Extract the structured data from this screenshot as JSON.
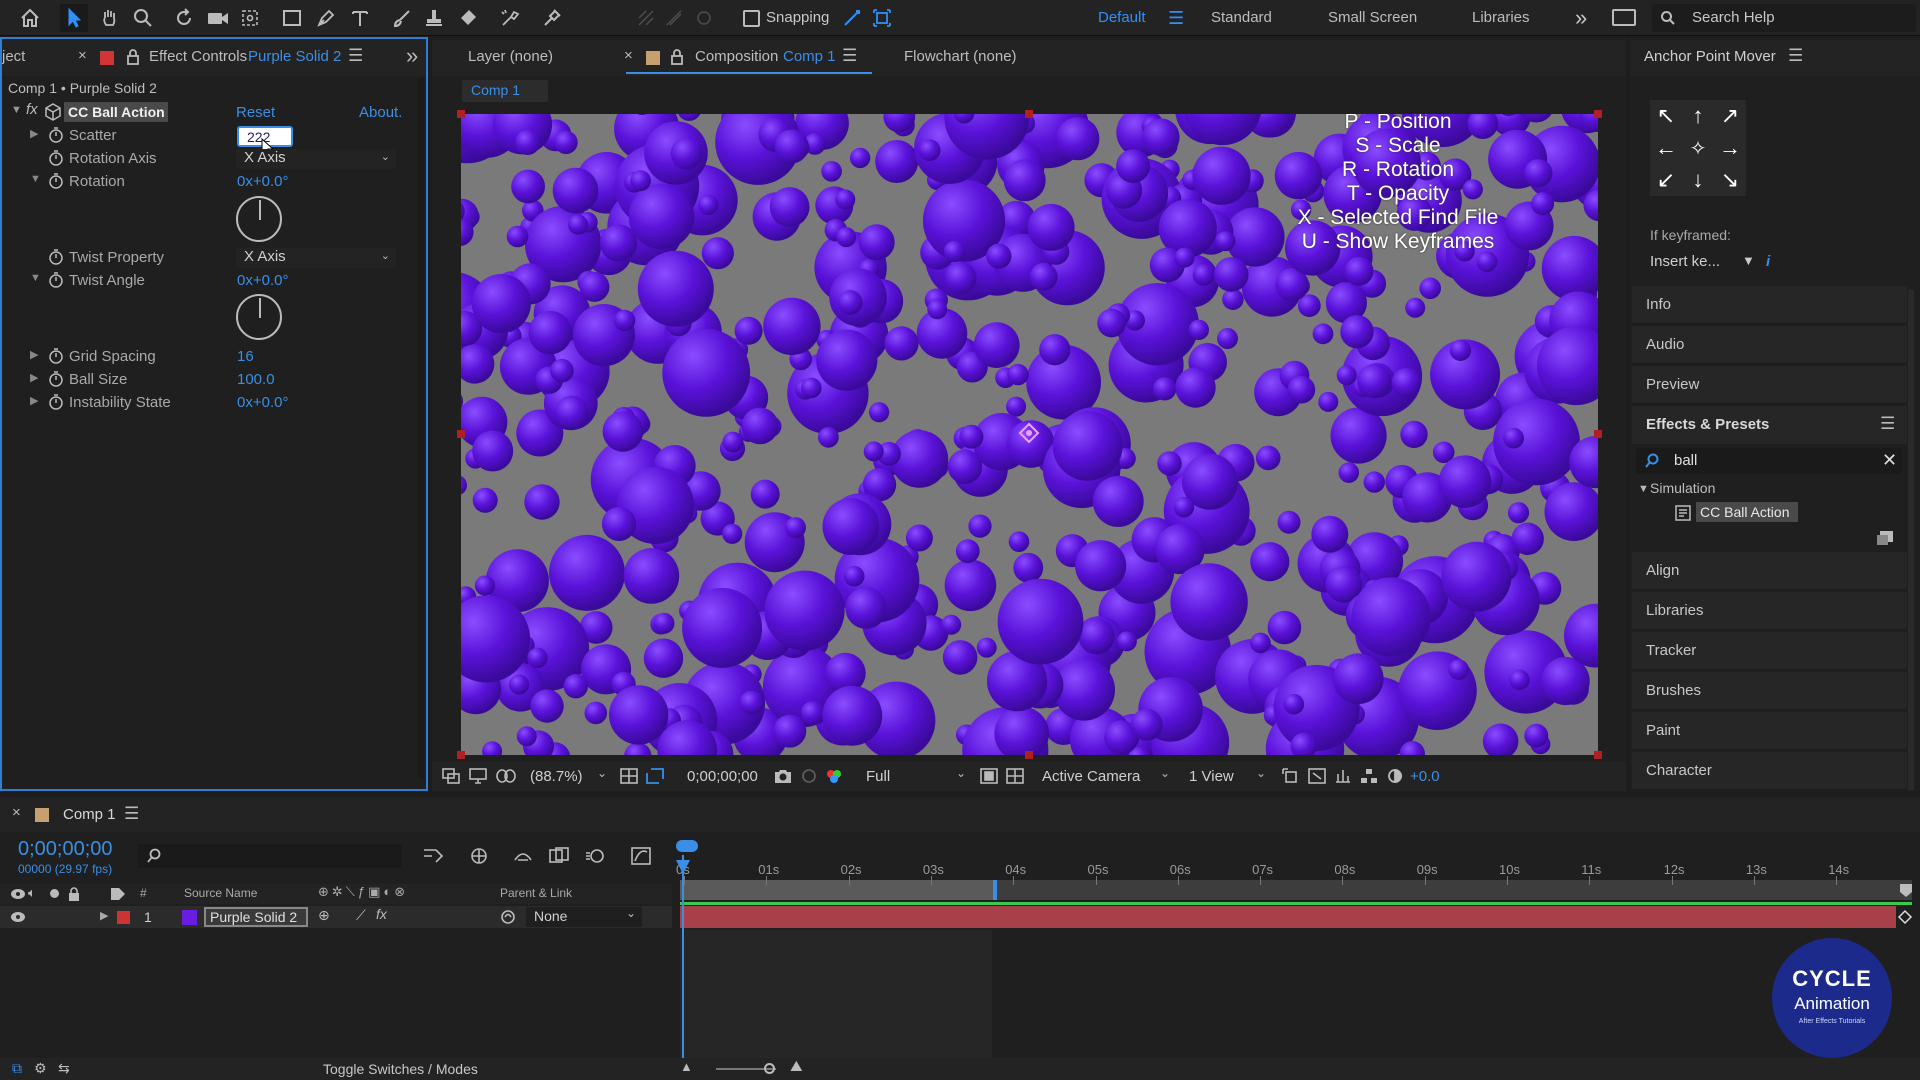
{
  "toolbar": {
    "snapping_label": "Snapping",
    "workspaces": [
      "Default",
      "Standard",
      "Small Screen",
      "Libraries"
    ],
    "overflow_glyph": "»",
    "search_placeholder": "Search Help"
  },
  "left_panel": {
    "tab_project_partial": "ject",
    "tab_effect_controls": "Effect Controls",
    "tab_effect_layer": "Purple Solid 2",
    "breadcrumb": "Comp 1 • Purple Solid 2",
    "effect_name": "CC Ball Action",
    "reset_label": "Reset",
    "about_label": "About.",
    "props": {
      "scatter": {
        "name": "Scatter",
        "value": "222"
      },
      "rotation_axis": {
        "name": "Rotation Axis",
        "value": "X Axis"
      },
      "rotation": {
        "name": "Rotation",
        "value": "0x+0.0°"
      },
      "twist_property": {
        "name": "Twist Property",
        "value": "X Axis"
      },
      "twist_angle": {
        "name": "Twist Angle",
        "value": "0x+0.0°"
      },
      "grid_spacing": {
        "name": "Grid Spacing",
        "value": "16"
      },
      "ball_size": {
        "name": "Ball Size",
        "value": "100.0"
      },
      "instability_state": {
        "name": "Instability State",
        "value": "0x+0.0°"
      }
    }
  },
  "viewer": {
    "tab_layer": "Layer (none)",
    "tab_composition": "Composition",
    "tab_comp_name": "Comp 1",
    "tab_flowchart": "Flowchart (none)",
    "comp_chip": "Comp 1",
    "hud_lines": [
      "P - Position",
      "S - Scale",
      "R - Rotation",
      "T - Opacity",
      "X - Selected Find File",
      "U - Show Keyframes"
    ],
    "background_color": "#7a7a7a",
    "ball_color": "#5a12d9",
    "bottom_bar": {
      "zoom": "(88.7%)",
      "timecode": "0;00;00;00",
      "resolution": "Full",
      "camera": "Active Camera",
      "views": "1 View",
      "exposure": "+0.0"
    }
  },
  "right_panel": {
    "title": "Anchor Point Mover",
    "if_keyframed_label": "If keyframed:",
    "insert_select": "Insert ke...",
    "info_glyph": "i",
    "items_top": [
      "Info",
      "Audio",
      "Preview"
    ],
    "effects_presets": {
      "title": "Effects & Presets",
      "search_value": "ball",
      "category": "Simulation",
      "result": "CC Ball Action"
    },
    "items_bottom": [
      "Align",
      "Libraries",
      "Tracker",
      "Brushes",
      "Paint",
      "Character"
    ]
  },
  "timeline": {
    "tab_label": "Comp 1",
    "timecode": "0;00;00;00",
    "timecode_sub": "00000 (29.97 fps)",
    "column_hash": "#",
    "column_source": "Source Name",
    "column_parent": "Parent & Link",
    "layer": {
      "index": "1",
      "name": "Purple Solid 2",
      "parent": "None",
      "label_color": "#cc3333",
      "swatch_color": "#6a1de0"
    },
    "ticks": [
      "0s",
      "01s",
      "02s",
      "03s",
      "04s",
      "05s",
      "06s",
      "07s",
      "08s",
      "09s",
      "10s",
      "11s",
      "12s",
      "13s",
      "14s"
    ],
    "toggle_label": "Toggle Switches / Modes"
  },
  "watermark": {
    "line1": "CYCLE",
    "line2": "Animation",
    "line3": "After Effects Tutorials"
  }
}
